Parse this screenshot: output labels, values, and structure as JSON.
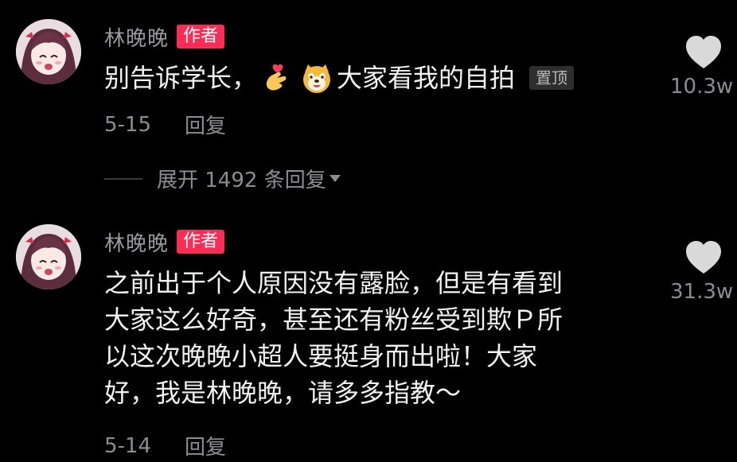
{
  "comments": [
    {
      "username": "林晚晚",
      "badge": "作者",
      "text_before_emoji": "别告诉学长，",
      "emoji_icons": [
        "finger-heart-icon",
        "grinning-dog-icon"
      ],
      "text_after_emoji": "大家看我的自拍",
      "pin_label": "置顶",
      "date": "5-15",
      "reply_label": "回复",
      "like_count": "10.3w",
      "expand_replies_label": "展开 1492 条回复"
    },
    {
      "username": "林晚晚",
      "badge": "作者",
      "text_lines": [
        "之前出于个人原因没有露脸，但是有看到",
        "大家这么好奇，甚至还有粉丝受到欺Ｐ所",
        "以这次晚晚小超人要挺身而出啦！大家",
        "好，我是林晚晚，请多多指教～"
      ],
      "date": "5-14",
      "reply_label": "回复",
      "like_count": "31.3w"
    }
  ],
  "colors": {
    "background": "#000000",
    "badge_author": "#fe2c55",
    "username": "#9a9a9e",
    "secondary_text": "#8d8d91",
    "heart": "#d9d9d9"
  }
}
